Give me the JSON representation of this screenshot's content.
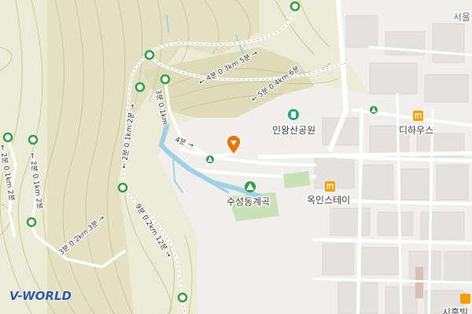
{
  "map": {
    "logo_text": "V-WORLD",
    "labels": {
      "place_top_right": "서울",
      "park": "인왕산공원",
      "house": "디하우스",
      "valley": "수성동계곡",
      "building": "옥인스테이",
      "bottom_right_partial": "시흥빌"
    },
    "trail_labels": {
      "r1": "← 4분 0.3km 5분 →",
      "r2": "← 5분 0.4km 6분",
      "r3": "← 2분 0.1km 2분 →",
      "r4": "3분 0.1km",
      "r5": "4분 →",
      "r6": "9분 0.2km 12분 →",
      "r7": "← 2분 0.1km 2분",
      "r8": "3분 0.2km 3분 →",
      "r9": "← 2분 0.1km 2분"
    },
    "colors": {
      "trail": "#ffffff",
      "trail_node": "#2f9e44",
      "poi_marker": "#e8750a",
      "poi_building": "#f0a000",
      "park_icon": "#1aa876",
      "water": "#9fd1e6"
    }
  }
}
